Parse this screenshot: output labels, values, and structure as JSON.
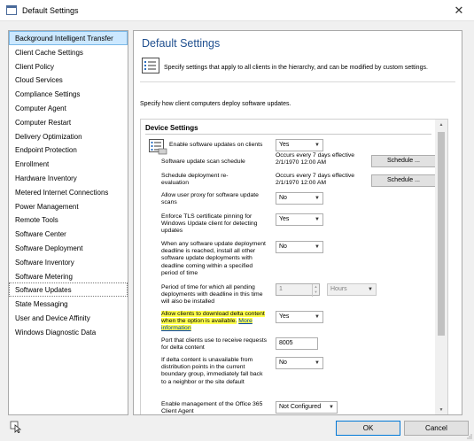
{
  "window": {
    "title": "Default Settings"
  },
  "sidebar": {
    "items": [
      "Background Intelligent Transfer",
      "Client Cache Settings",
      "Client Policy",
      "Cloud Services",
      "Compliance Settings",
      "Computer Agent",
      "Computer Restart",
      "Delivery Optimization",
      "Endpoint Protection",
      "Enrollment",
      "Hardware Inventory",
      "Metered Internet Connections",
      "Power Management",
      "Remote Tools",
      "Software Center",
      "Software Deployment",
      "Software Inventory",
      "Software Metering",
      "Software Updates",
      "State Messaging",
      "User and Device Affinity",
      "Windows Diagnostic Data"
    ]
  },
  "main": {
    "title": "Default Settings",
    "description": "Specify settings that apply to all clients in the hierarchy, and can be modified by custom settings.",
    "subtext": "Specify how client computers deploy software updates.",
    "section_title": "Device Settings",
    "rows": {
      "enable_updates": {
        "label": "Enable software updates on clients",
        "value": "Yes"
      },
      "scan_schedule": {
        "label": "Software update scan schedule",
        "occurs": "Occurs every 7 days effective 2/1/1970 12:00 AM",
        "button": "Schedule ..."
      },
      "reevaluation": {
        "label": "Schedule deployment re-evaluation",
        "occurs": "Occurs every 7 days effective 2/1/1970 12:00 AM",
        "button": "Schedule ..."
      },
      "user_proxy": {
        "label": "Allow user proxy for software update scans",
        "value": "No"
      },
      "tls_pinning": {
        "label": "Enforce TLS certificate pinning for Windows Update client for detecting updates",
        "value": "Yes"
      },
      "deadline": {
        "label": "When any software update deployment deadline is reached, install all other software update deployments with deadline coming within a specified period of time",
        "value": "No"
      },
      "period": {
        "label": "Period of time for which all pending deployments with deadline in this time will also be installed",
        "value": "1",
        "unit": "Hours"
      },
      "delta": {
        "label": "Allow clients to download delta content when the option is available.",
        "link": "More information",
        "value": "Yes"
      },
      "port": {
        "label": "Port that clients use to receive requests for delta content",
        "value": "8005"
      },
      "fallback": {
        "label": "If delta content is unavailable from distribution points in the current boundary group, immediately fall back to a neighbor or the site default",
        "value": "No"
      },
      "office": {
        "label": "Enable management of the Office 365 Client Agent",
        "value": "Not Configured"
      }
    }
  },
  "footer": {
    "ok": "OK",
    "cancel": "Cancel"
  }
}
